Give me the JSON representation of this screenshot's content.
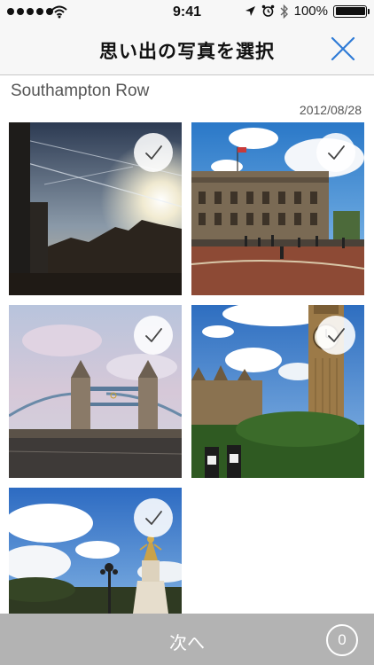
{
  "status_bar": {
    "time": "9:41",
    "battery_text": "100%",
    "signal_icon": "signal-dots-icon",
    "wifi_icon": "wifi-icon",
    "location_icon": "location-arrow-icon",
    "alarm_icon": "alarm-icon",
    "bluetooth_icon": "bluetooth-icon",
    "battery_icon": "battery-icon"
  },
  "nav": {
    "title": "思い出の写真を選択",
    "close_icon": "close-icon",
    "accent_color": "#2f7bd6"
  },
  "section": {
    "title": "Southampton Row",
    "date": "2012/08/28"
  },
  "photos": [
    {
      "subject": "sunlit-buildings-photo",
      "selected": true,
      "check_icon": "checkmark-icon"
    },
    {
      "subject": "palace-square-photo",
      "selected": true,
      "check_icon": "checkmark-icon"
    },
    {
      "subject": "tower-bridge-photo",
      "selected": true,
      "check_icon": "checkmark-icon"
    },
    {
      "subject": "big-ben-photo",
      "selected": true,
      "check_icon": "checkmark-icon"
    },
    {
      "subject": "monument-statue-photo",
      "selected": true,
      "check_icon": "checkmark-icon"
    }
  ],
  "bottom_bar": {
    "next_label": "次へ",
    "count": "0",
    "background_color": "#b3b3b3"
  }
}
